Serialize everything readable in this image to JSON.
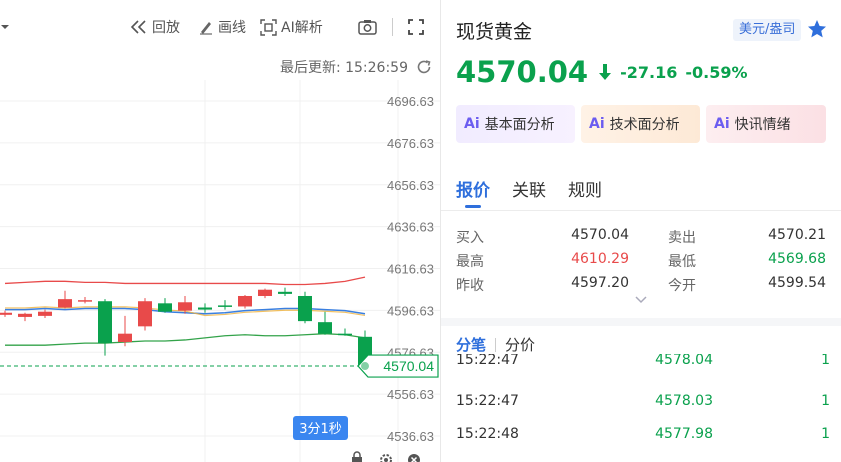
{
  "toolbar": {
    "replay_label": "回放",
    "draw_label": "画线",
    "ai_label": "AI解析"
  },
  "update": {
    "label": "最后更新: 15:26:59"
  },
  "chart": {
    "y_ticks": [
      "4696.63",
      "4676.63",
      "4656.63",
      "4636.63",
      "4616.63",
      "4596.63",
      "4576.63",
      "4556.63",
      "4536.63"
    ],
    "current_price_tag": "4570.04",
    "countdown": "3分1秒"
  },
  "chart_data": {
    "type": "candlestick",
    "ylim": [
      4536.63,
      4696.63
    ],
    "candles": [
      {
        "open": 4594.5,
        "close": 4595.5,
        "high": 4596.5,
        "low": 4593.5
      },
      {
        "open": 4593.5,
        "close": 4595.0,
        "high": 4595.5,
        "low": 4591.5
      },
      {
        "open": 4594.0,
        "close": 4596.0,
        "high": 4597.0,
        "low": 4593.0
      },
      {
        "open": 4598.0,
        "close": 4602.0,
        "high": 4606.0,
        "low": 4597.5
      },
      {
        "open": 4601.0,
        "close": 4601.5,
        "high": 4603.0,
        "low": 4600.0
      },
      {
        "open": 4601.0,
        "close": 4581.0,
        "high": 4602.0,
        "low": 4575.0
      },
      {
        "open": 4581.5,
        "close": 4585.5,
        "high": 4594.0,
        "low": 4579.5
      },
      {
        "open": 4589.0,
        "close": 4601.0,
        "high": 4602.5,
        "low": 4587.0
      },
      {
        "open": 4600.0,
        "close": 4596.0,
        "high": 4602.5,
        "low": 4595.5
      },
      {
        "open": 4596.5,
        "close": 4600.5,
        "high": 4603.5,
        "low": 4595.0
      },
      {
        "open": 4598.0,
        "close": 4597.0,
        "high": 4600.0,
        "low": 4595.5
      },
      {
        "open": 4599.0,
        "close": 4598.5,
        "high": 4601.5,
        "low": 4597.0
      },
      {
        "open": 4598.5,
        "close": 4603.5,
        "high": 4604.0,
        "low": 4597.5
      },
      {
        "open": 4603.5,
        "close": 4606.5,
        "high": 4607.0,
        "low": 4602.5
      },
      {
        "open": 4605.5,
        "close": 4604.5,
        "high": 4607.5,
        "low": 4603.5
      },
      {
        "open": 4603.5,
        "close": 4591.5,
        "high": 4605.5,
        "low": 4590.5
      },
      {
        "open": 4591.0,
        "close": 4585.5,
        "high": 4596.0,
        "low": 4585.0
      },
      {
        "open": 4585.5,
        "close": 4585.0,
        "high": 4588.0,
        "low": 4584.5
      },
      {
        "open": 4584.0,
        "close": 4570.04,
        "high": 4587.0,
        "low": 4569.68
      }
    ],
    "bands": {
      "upper": [
        4609.5,
        4610.0,
        4610.5,
        4610.5,
        4610.0,
        4610.0,
        4609.5,
        4609.5,
        4609.5,
        4609.5,
        4609.5,
        4609.5,
        4609.5,
        4609.5,
        4609.0,
        4609.0,
        4609.5,
        4610.5,
        4612.5
      ],
      "middle": [
        4597.0,
        4597.0,
        4597.5,
        4597.0,
        4597.5,
        4597.5,
        4597.5,
        4597.0,
        4596.0,
        4595.5,
        4595.0,
        4595.5,
        4596.5,
        4597.0,
        4597.5,
        4597.5,
        4597.0,
        4596.5,
        4595.0
      ],
      "lower": [
        4580.0,
        4580.0,
        4580.0,
        4580.5,
        4581.0,
        4581.0,
        4581.5,
        4582.0,
        4582.0,
        4582.5,
        4583.5,
        4584.5,
        4585.0,
        4584.5,
        4584.5,
        4585.0,
        4585.5,
        4585.0,
        4583.5
      ]
    }
  },
  "quote": {
    "title": "现货黄金",
    "unit_badge": "美元/盎司",
    "price": "4570.04",
    "change": "-27.16",
    "change_pct": "-0.59%",
    "ai_buttons": [
      "基本面分析",
      "技术面分析",
      "快讯情绪"
    ],
    "tabs": [
      "报价",
      "关联",
      "规则"
    ],
    "rows": [
      {
        "l1": "买入",
        "v1": "4570.04",
        "l2": "卖出",
        "v2": "4570.21"
      },
      {
        "l1": "最高",
        "v1": "4610.29",
        "l2": "最低",
        "v2": "4569.68"
      },
      {
        "l1": "昨收",
        "v1": "4597.20",
        "l2": "今开",
        "v2": "4599.54"
      }
    ],
    "tick_tabs": [
      "分笔",
      "分价"
    ],
    "ticks": [
      {
        "time": "15:22:47",
        "price": "4578.04",
        "vol": "1"
      },
      {
        "time": "15:22:47",
        "price": "4578.03",
        "vol": "1"
      },
      {
        "time": "15:22:48",
        "price": "4577.98",
        "vol": "1"
      }
    ]
  },
  "colors": {
    "up": "#e84a4a",
    "down": "#0aa14d",
    "accent": "#2f6fdc",
    "band_upper": "#e84a4a",
    "band_middle": "#3a7fe0",
    "band_lower": "#33a34a",
    "ma": "#f0b23a"
  }
}
